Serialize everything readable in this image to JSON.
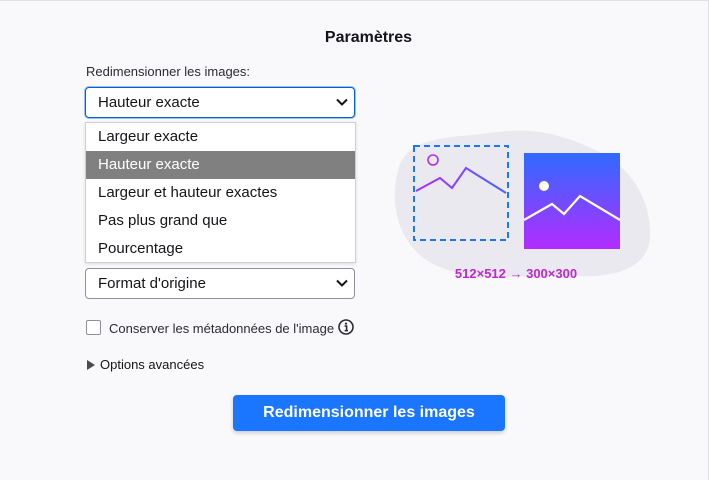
{
  "settings": {
    "title": "Paramètres",
    "resize_label": "Redimensionner les images:",
    "mode_select": {
      "value": "Hauteur exacte",
      "options": [
        "Largeur exacte",
        "Hauteur exacte",
        "Largeur et hauteur exactes",
        "Pas plus grand que",
        "Pourcentage"
      ],
      "selected_index": 1
    },
    "format_select": {
      "value": "Format d'origine"
    },
    "keep_metadata": {
      "label": "Conserver les métadonnées de l'image",
      "checked": false
    },
    "advanced_label": "Options avancées",
    "submit_label": "Redimensionner les images"
  },
  "illustration": {
    "dimensions_text": "512×512 → 300×300",
    "colors": {
      "accent_blue": "#1a75ff",
      "magenta": "#c026d3",
      "gradient_top": "#2f6bff",
      "gradient_bottom": "#b32cff",
      "blob": "#e9e9ef"
    }
  },
  "colors": {
    "focus_border": "#0060df",
    "selected_option_bg": "#808080"
  }
}
